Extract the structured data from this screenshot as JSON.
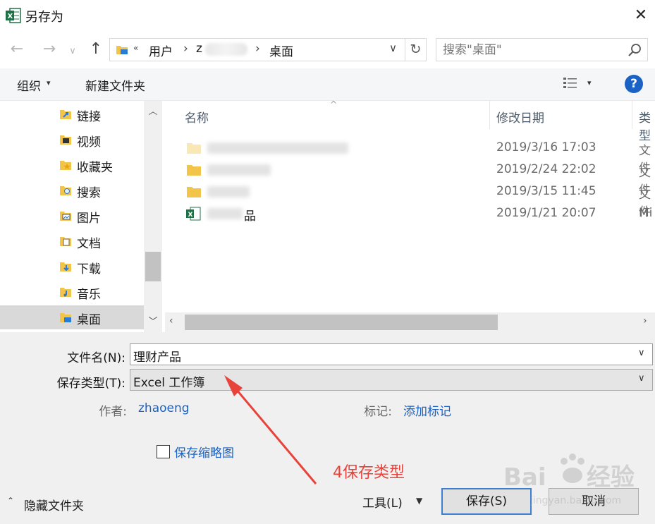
{
  "window": {
    "title": "另存为",
    "close_glyph": "✕"
  },
  "nav": {
    "back_glyph": "←",
    "forward_glyph": "→",
    "recent_glyph": "∨",
    "up_glyph": "↑",
    "address_overflow": "«",
    "address_segments": [
      "用户",
      "z",
      "桌面"
    ],
    "address_separator": "›",
    "refresh_glyph": "↻"
  },
  "search": {
    "placeholder": "搜索\"桌面\""
  },
  "toolbar": {
    "organize_label": "组织",
    "organize_caret": "▾",
    "new_folder_label": "新建文件夹",
    "view_caret": "▾",
    "help_label": "?"
  },
  "sidebar": {
    "scroll_up": "︿",
    "scroll_down": "﹀",
    "items": [
      {
        "label": "链接",
        "icon": "link-folder-icon",
        "selected": false
      },
      {
        "label": "视频",
        "icon": "video-folder-icon",
        "selected": false
      },
      {
        "label": "收藏夹",
        "icon": "favorites-folder-icon",
        "selected": false
      },
      {
        "label": "搜索",
        "icon": "search-folder-icon",
        "selected": false
      },
      {
        "label": "图片",
        "icon": "pictures-folder-icon",
        "selected": false
      },
      {
        "label": "文档",
        "icon": "documents-folder-icon",
        "selected": false
      },
      {
        "label": "下载",
        "icon": "downloads-folder-icon",
        "selected": false
      },
      {
        "label": "音乐",
        "icon": "music-folder-icon",
        "selected": false
      },
      {
        "label": "桌面",
        "icon": "desktop-folder-icon",
        "selected": true
      }
    ]
  },
  "filelist": {
    "sort_glyph": "^",
    "columns": [
      "名称",
      "修改日期",
      "类型"
    ],
    "rows": [
      {
        "name_visible": "",
        "date": "2019/3/16 17:03",
        "type": "文件",
        "icon": "folder-icon"
      },
      {
        "name_visible": "",
        "date": "2019/2/24 22:02",
        "type": "文件",
        "icon": "folder-icon"
      },
      {
        "name_visible": "",
        "date": "2019/3/15 11:45",
        "type": "文件",
        "icon": "folder-icon"
      },
      {
        "name_visible": "品",
        "date": "2019/1/21 20:07",
        "type": "Mi",
        "icon": "excel-file-icon"
      }
    ],
    "hscroll_left": "‹",
    "hscroll_right": "›"
  },
  "form": {
    "filename_label": "文件名(N):",
    "filename_value": "理财产品",
    "filetype_label": "保存类型(T):",
    "filetype_value": "Excel 工作簿",
    "dropdown_caret": "∨",
    "author_label": "作者:",
    "author_value": "zhaoeng",
    "tags_label": "标记:",
    "tags_value": "添加标记",
    "thumbnail_label": "保存缩略图",
    "thumbnail_checked": false,
    "hide_folders_label": "隐藏文件夹",
    "hide_folders_caret": "⌃",
    "tools_label": "工具(L)",
    "tools_caret": "▼",
    "save_label": "保存(S)",
    "cancel_label": "取消"
  },
  "annotation": {
    "label": "4保存类型",
    "color": "#e8433b"
  },
  "colors": {
    "accent": "#1a62c4",
    "selected_nav": "#d9d9d9",
    "form_bg": "#f0f0f0"
  }
}
